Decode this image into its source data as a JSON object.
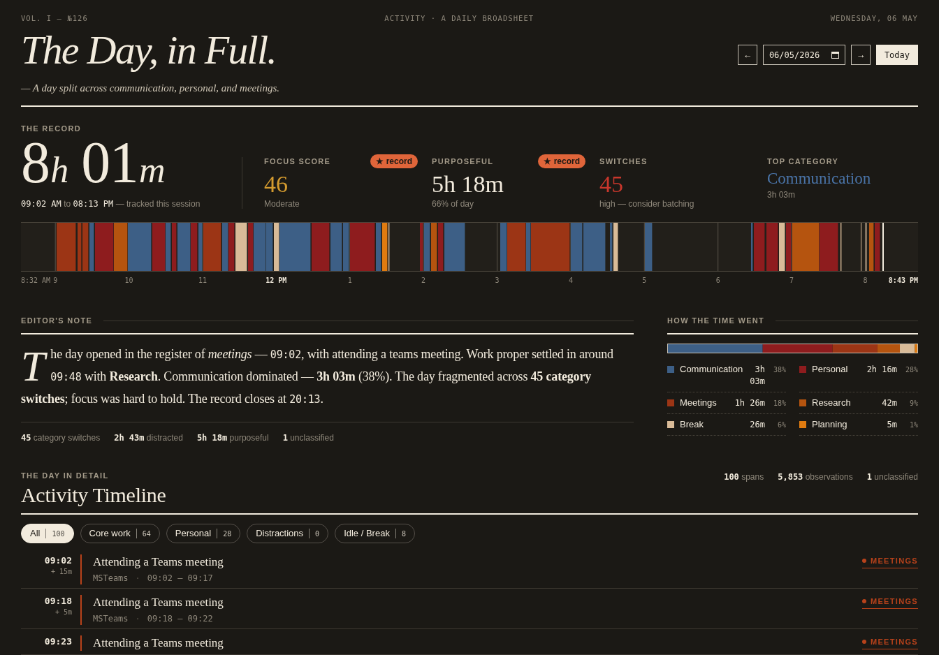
{
  "masthead": {
    "issue": "VOL. I — №126",
    "section": "ACTIVITY · A DAILY BROADSHEET",
    "date": "WEDNESDAY, 06 MAY"
  },
  "header": {
    "title": "The Day, in Full.",
    "subtitle": "— A day split across communication, personal, and meetings.",
    "nav": {
      "previous": "←",
      "date_value": "06/05/2026",
      "next": "→",
      "today": "Today"
    }
  },
  "record": {
    "label": "THE RECORD",
    "total": [
      {
        "kind": "number",
        "text": "8"
      },
      {
        "kind": "unit",
        "text": "h"
      },
      {
        "kind": "number",
        "text": "01"
      },
      {
        "kind": "unit",
        "text": "m"
      }
    ],
    "range": {
      "start": "09:02 AM",
      "joiner": "to",
      "end": "08:13 PM",
      "note": "— tracked this session"
    },
    "stats": [
      {
        "kind": "figure",
        "label": "FOCUS SCORE",
        "badge": "★ record",
        "value": "46",
        "color": "#d49b2f",
        "note": "Moderate"
      },
      {
        "kind": "figure",
        "label": "PURPOSEFUL",
        "badge": "★ record",
        "value": "5h 18m",
        "color": "#f2ebdd",
        "note": "66% of day"
      },
      {
        "kind": "figure",
        "label": "SWITCHES",
        "value": "45",
        "color": "#c9372c",
        "note": "high — consider batching"
      },
      {
        "kind": "name",
        "label": "TOP CATEGORY",
        "value": "Communication",
        "color": "#4a74a8",
        "note": "3h 03m"
      }
    ]
  },
  "strip": {
    "axis_labels": [
      {
        "text": "8:32 AM",
        "strong": false
      },
      {
        "text": "9",
        "strong": false
      },
      {
        "text": "10",
        "strong": false
      },
      {
        "text": "11",
        "strong": false
      },
      {
        "text": "12 PM",
        "strong": true
      },
      {
        "text": "1",
        "strong": false
      },
      {
        "text": "2",
        "strong": false
      },
      {
        "text": "3",
        "strong": false
      },
      {
        "text": "4",
        "strong": false
      },
      {
        "text": "5",
        "strong": false
      },
      {
        "text": "6",
        "strong": false
      },
      {
        "text": "7",
        "strong": false
      },
      {
        "text": "8",
        "strong": false
      },
      {
        "text": "8:43 PM",
        "strong": true
      }
    ]
  },
  "note": {
    "label": "EDITOR'S NOTE",
    "parts": [
      {
        "kind": "text",
        "text": "The day opened in the register of *meetings* — "
      },
      {
        "kind": "time",
        "text": "09:02"
      },
      {
        "kind": "text",
        "text": ", with attending a teams meeting. Work proper settled in around "
      },
      {
        "kind": "time",
        "text": "09:48"
      },
      {
        "kind": "text",
        "text": " with **Research**. Communication dominated — **3h 03m** (38%). The day fragmented across **45 category switches**; focus was hard to hold. The record closes at "
      },
      {
        "kind": "time",
        "text": "20:13"
      },
      {
        "kind": "text",
        "text": "."
      }
    ],
    "summary": [
      "**45** category switches",
      "**2h 43m** distracted",
      "**5h 18m** purposeful",
      "**1** unclassified"
    ]
  },
  "breakdown": {
    "label": "HOW THE TIME WENT",
    "categories": [
      {
        "name": "Communication",
        "duration": "3h 03m",
        "share": "38%",
        "color": "#3d5f86"
      },
      {
        "name": "Personal",
        "duration": "2h 16m",
        "share": "28%",
        "color": "#8e1c1e"
      },
      {
        "name": "Meetings",
        "duration": "1h 26m",
        "share": "18%",
        "color": "#9c3515"
      },
      {
        "name": "Research",
        "duration": "42m",
        "share": "9%",
        "color": "#b5540f"
      },
      {
        "name": "Break",
        "duration": "26m",
        "share": "6%",
        "color": "#d9bb98"
      },
      {
        "name": "Planning",
        "duration": "5m",
        "share": "1%",
        "color": "#e07b10"
      }
    ]
  },
  "detail": {
    "label": "THE DAY IN DETAIL",
    "title": "Activity Timeline",
    "counts": [
      "**100** spans",
      "**5,853** observations",
      "**1** unclassified"
    ],
    "filters": [
      {
        "label": "All",
        "count": "100",
        "selected": true
      },
      {
        "label": "Core work",
        "count": "64",
        "selected": false
      },
      {
        "label": "Personal",
        "count": "28",
        "selected": false
      },
      {
        "label": "Distractions",
        "count": "0",
        "selected": false
      },
      {
        "label": "Idle / Break",
        "count": "8",
        "selected": false
      }
    ],
    "rows": [
      {
        "time": "09:02",
        "duration": "+ 15m",
        "title": "Attending a Teams meeting",
        "source": "MSTeams",
        "separator": "·",
        "range": "09:02 — 09:17",
        "category": "MEETINGS",
        "color": "#b8421b"
      },
      {
        "time": "09:18",
        "duration": "+ 5m",
        "title": "Attending a Teams meeting",
        "source": "MSTeams",
        "separator": "·",
        "range": "09:18 — 09:22",
        "category": "MEETINGS",
        "color": "#b8421b"
      },
      {
        "time": "09:23",
        "title": "Attending a Teams meeting",
        "category": "MEETINGS",
        "color": "#b8421b"
      }
    ]
  }
}
